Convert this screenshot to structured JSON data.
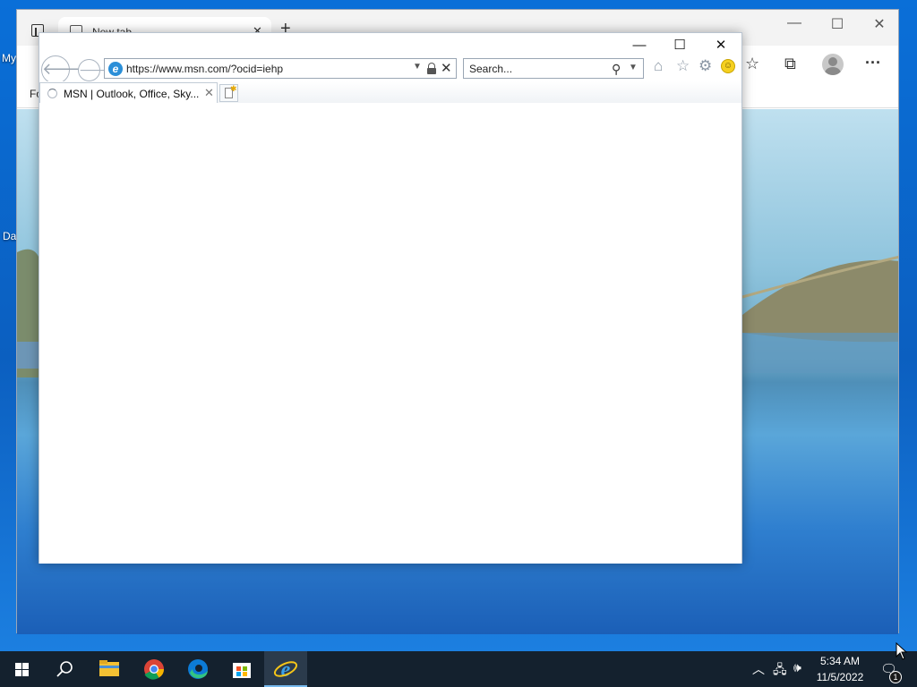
{
  "desktop": {
    "icon_label_1": "My",
    "icon_label_2": "Da"
  },
  "edge": {
    "tab_title": "New tab",
    "tab_close": "✕",
    "new_tab_symbol": "+",
    "favorites_text": "Fo",
    "controls": {
      "minimize": "—",
      "maximize": "☐",
      "close": "✕"
    },
    "toolbar": {
      "favorites": "☆",
      "collections": "⧉",
      "more": "···"
    }
  },
  "ie": {
    "window_controls": {
      "minimize": "—",
      "maximize": "☐",
      "close": "✕"
    },
    "address_url": "https://www.msn.com/?ocid=iehp",
    "address_icon": "e",
    "search_placeholder": "Search...",
    "tab_title": "MSN | Outlook, Office, Sky...",
    "tab_close": "✕",
    "commands": {
      "home": "⌂",
      "favorites": "☆",
      "tools": "⚙",
      "feedback": "☺"
    }
  },
  "taskbar": {
    "time": "5:34 AM",
    "date": "11/5/2022",
    "notification_count": "1",
    "pinned": [
      "start",
      "search",
      "file-explorer",
      "chrome",
      "edge",
      "store",
      "internet-explorer"
    ],
    "active_app": "internet-explorer"
  },
  "colors": {
    "taskbar": "#14212e",
    "desktop_accent": "#0b5fc0",
    "ie_brand": "#2b8fd8"
  }
}
